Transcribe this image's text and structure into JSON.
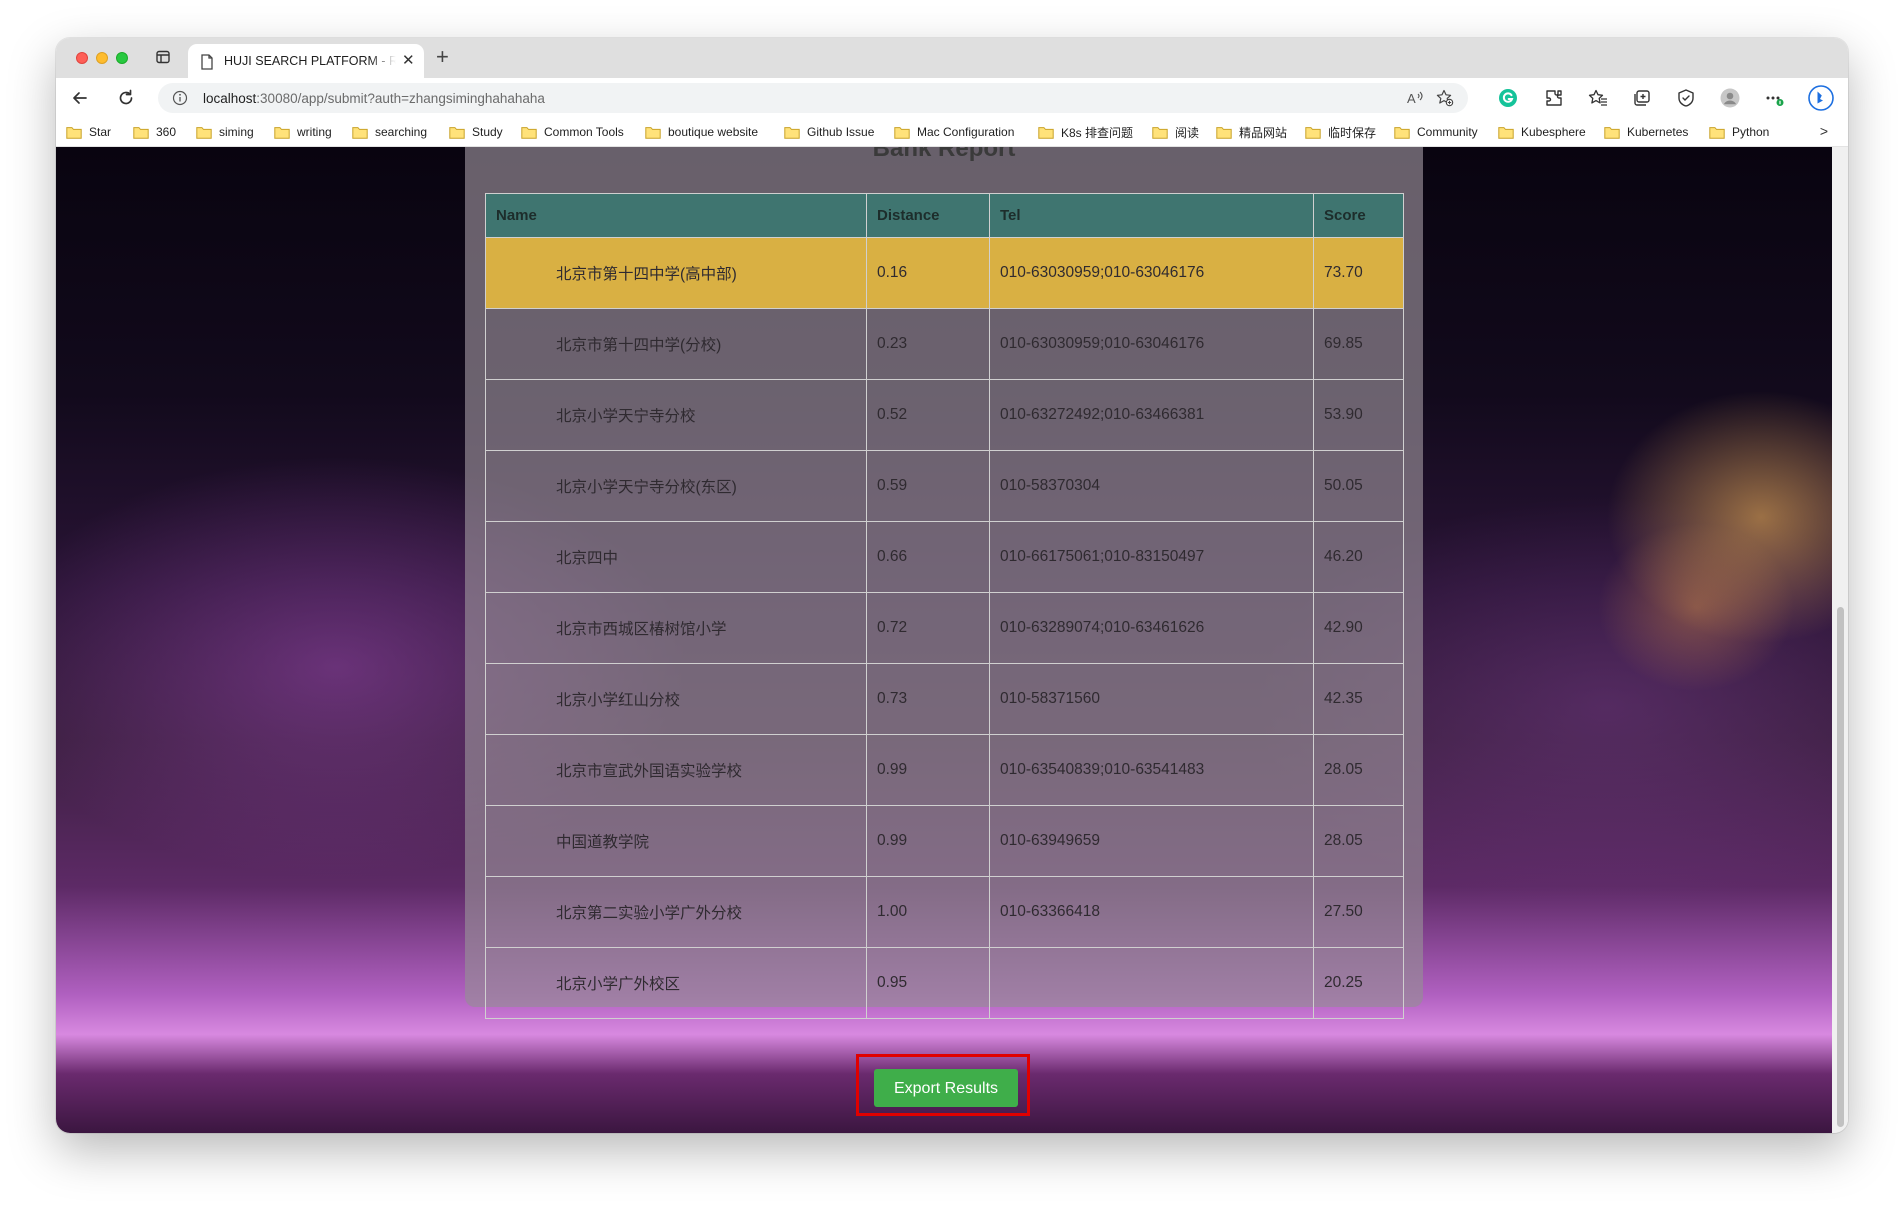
{
  "browser": {
    "tab_title": "HUJI SEARCH PLATFORM - Re",
    "tab_close": "✕",
    "new_tab": "+",
    "url_host": "localhost",
    "url_path": ":30080/app/submit?auth=zhangsiminghahahaha",
    "bookmarks": [
      "Star",
      "360",
      "siming",
      "writing",
      "searching",
      "Study",
      "Common Tools",
      "boutique website",
      "Github Issue",
      "Mac Configuration",
      "K8s 排查问题",
      "阅读",
      "精品网站",
      "临时保存",
      "Community",
      "Kubesphere",
      "Kubernetes",
      "Python"
    ],
    "bookmarks_more": ">"
  },
  "report": {
    "title": "Bank Report",
    "headers": [
      "Name",
      "Distance",
      "Tel",
      "Score"
    ],
    "rows": [
      {
        "name": "北京市第十四中学(高中部)",
        "distance": "0.16",
        "tel": "010-63030959;010-63046176",
        "score": "73.70",
        "highlight": true
      },
      {
        "name": "北京市第十四中学(分校)",
        "distance": "0.23",
        "tel": "010-63030959;010-63046176",
        "score": "69.85"
      },
      {
        "name": "北京小学天宁寺分校",
        "distance": "0.52",
        "tel": "010-63272492;010-63466381",
        "score": "53.90"
      },
      {
        "name": "北京小学天宁寺分校(东区)",
        "distance": "0.59",
        "tel": "010-58370304",
        "score": "50.05"
      },
      {
        "name": "北京四中",
        "distance": "0.66",
        "tel": "010-66175061;010-83150497",
        "score": "46.20"
      },
      {
        "name": "北京市西城区椿树馆小学",
        "distance": "0.72",
        "tel": "010-63289074;010-63461626",
        "score": "42.90"
      },
      {
        "name": "北京小学红山分校",
        "distance": "0.73",
        "tel": "010-58371560",
        "score": "42.35"
      },
      {
        "name": "北京市宣武外国语实验学校",
        "distance": "0.99",
        "tel": "010-63540839;010-63541483",
        "score": "28.05"
      },
      {
        "name": "中国道教学院",
        "distance": "0.99",
        "tel": "010-63949659",
        "score": "28.05"
      },
      {
        "name": "北京第二实验小学广外分校",
        "distance": "1.00",
        "tel": "010-63366418",
        "score": "27.50"
      },
      {
        "name": "北京小学广外校区",
        "distance": "0.95",
        "tel": "",
        "score": "20.25"
      }
    ]
  },
  "export_label": "Export Results",
  "colors": {
    "header_bg": "#3f7570",
    "highlight_row": "#d9b043",
    "export_button": "#3fae4a",
    "callout_border": "#e00000"
  }
}
